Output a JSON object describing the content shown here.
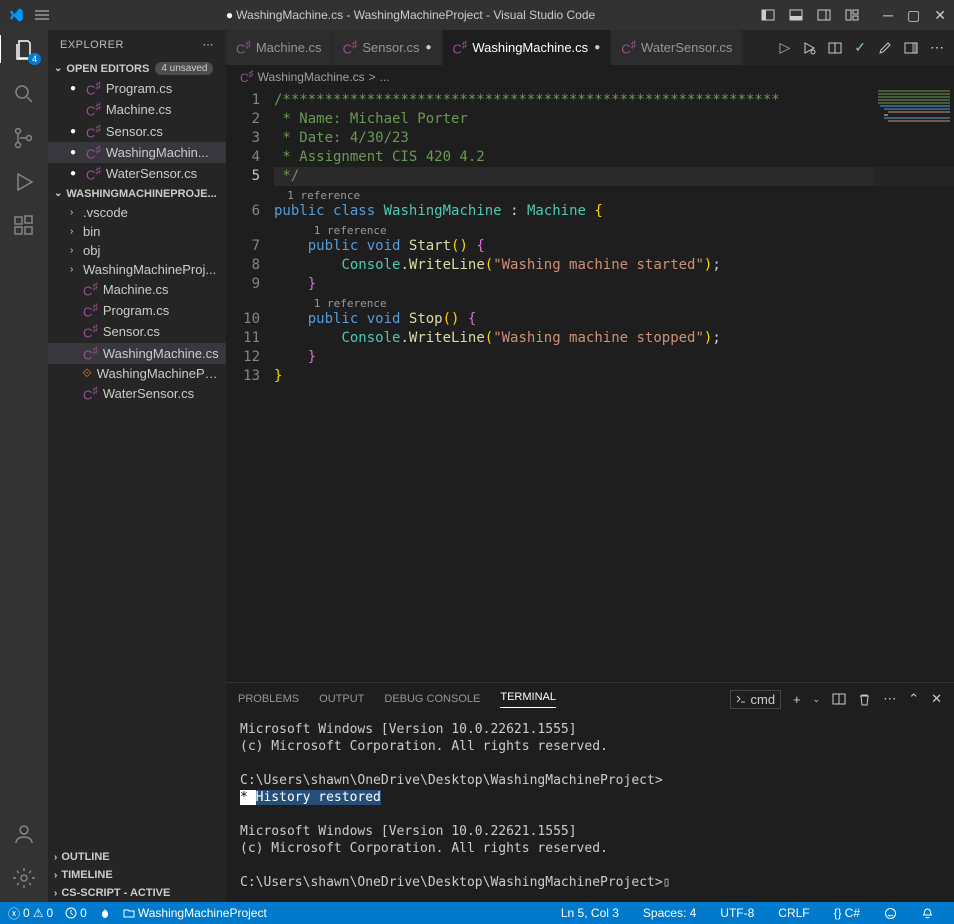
{
  "titlebar": {
    "title_prefix": "●",
    "title": "WashingMachine.cs - WashingMachineProject - Visual Studio Code"
  },
  "activitybar": {
    "badge": "4"
  },
  "sidebar": {
    "title": "EXPLORER",
    "openEditors": {
      "label": "OPEN EDITORS",
      "badge": "4 unsaved",
      "items": [
        {
          "mod": true,
          "name": "Program.cs"
        },
        {
          "mod": false,
          "name": "Machine.cs"
        },
        {
          "mod": true,
          "name": "Sensor.cs"
        },
        {
          "mod": true,
          "name": "WashingMachin...",
          "active": true
        },
        {
          "mod": true,
          "name": "WaterSensor.cs"
        }
      ]
    },
    "project": {
      "label": "WASHINGMACHINEPROJE...",
      "folders": [
        ".vscode",
        "bin",
        "obj"
      ],
      "files": [
        {
          "name": "WashingMachineProj...",
          "type": "folder"
        },
        {
          "name": "Machine.cs",
          "type": "cs"
        },
        {
          "name": "Program.cs",
          "type": "cs"
        },
        {
          "name": "Sensor.cs",
          "type": "cs"
        },
        {
          "name": "WashingMachine.cs",
          "type": "cs",
          "active": true
        },
        {
          "name": "WashingMachineProj...",
          "type": "csproj"
        },
        {
          "name": "WaterSensor.cs",
          "type": "cs"
        }
      ]
    },
    "outline": "OUTLINE",
    "timeline": "TIMELINE",
    "csscript": "CS-SCRIPT - ACTIVE"
  },
  "tabs": [
    {
      "name": "Machine.cs",
      "modified": false
    },
    {
      "name": "Sensor.cs",
      "modified": true
    },
    {
      "name": "WashingMachine.cs",
      "modified": true,
      "active": true
    },
    {
      "name": "WaterSensor.cs",
      "modified": false
    }
  ],
  "breadcrumb": {
    "file": "WashingMachine.cs",
    "sep": ">",
    "rest": "..."
  },
  "code": {
    "lines": [
      {
        "n": 1,
        "comment": "/***********************************************************"
      },
      {
        "n": 2,
        "comment": " * Name: Michael Porter"
      },
      {
        "n": 3,
        "comment": " * Date: 4/30/23"
      },
      {
        "n": 4,
        "comment": " * Assignment CIS 420 4.2"
      },
      {
        "n": 5,
        "comment": " */",
        "current": true
      }
    ],
    "ref1": "1 reference",
    "classline": {
      "n": 6,
      "kw1": "public",
      "kw2": "class",
      "name": "WashingMachine",
      "colon": ":",
      "base": "Machine",
      "brace": "{"
    },
    "ref2": "1 reference",
    "startline": {
      "n": 7,
      "kw1": "public",
      "kw2": "void",
      "name": "Start",
      "rest": "() {"
    },
    "console1": {
      "n": 8,
      "cls": "Console",
      "method": "WriteLine",
      "str": "\"Washing machine started\""
    },
    "close1": {
      "n": 9,
      "brace": "}"
    },
    "ref3": "1 reference",
    "stopline": {
      "n": 10,
      "kw1": "public",
      "kw2": "void",
      "name": "Stop",
      "rest": "() {"
    },
    "console2": {
      "n": 11,
      "cls": "Console",
      "method": "WriteLine",
      "str": "\"Washing machine stopped\""
    },
    "close2": {
      "n": 12,
      "brace": "}"
    },
    "close3": {
      "n": 13,
      "brace": "}"
    }
  },
  "panel": {
    "tabs": {
      "problems": "PROBLEMS",
      "output": "OUTPUT",
      "debug": "DEBUG CONSOLE",
      "terminal": "TERMINAL"
    },
    "cmd": "cmd",
    "terminal": {
      "l1": "Microsoft Windows [Version 10.0.22621.1555]",
      "l2": "(c) Microsoft Corporation. All rights reserved.",
      "l3": "C:\\Users\\shawn\\OneDrive\\Desktop\\WashingMachineProject>",
      "star": " * ",
      "hist": " History restored ",
      "l4": "Microsoft Windows [Version 10.0.22621.1555]",
      "l5": "(c) Microsoft Corporation. All rights reserved.",
      "l6": "C:\\Users\\shawn\\OneDrive\\Desktop\\WashingMachineProject>",
      "cursor": "▯"
    }
  },
  "statusbar": {
    "errors": "0",
    "warnings": "0",
    "port": "0",
    "project": "WashingMachineProject",
    "lncol": "Ln 5, Col 3",
    "spaces": "Spaces: 4",
    "encoding": "UTF-8",
    "eol": "CRLF",
    "lang": "C#"
  }
}
